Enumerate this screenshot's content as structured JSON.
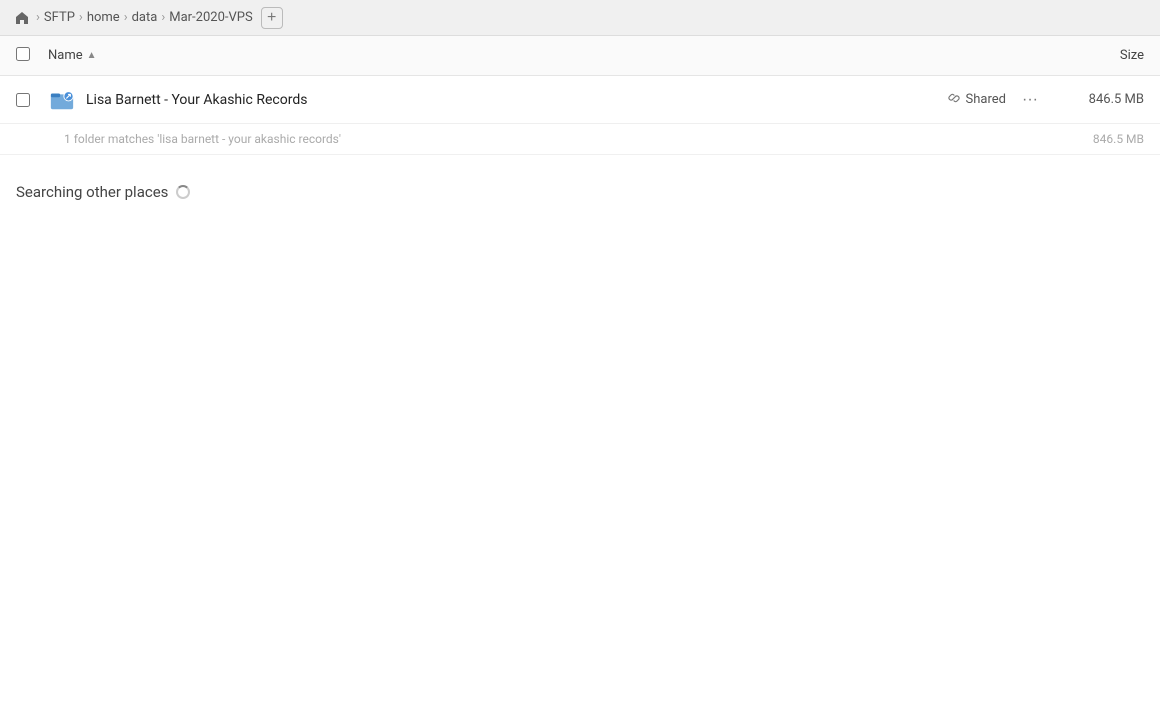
{
  "breadcrumb": {
    "home_label": "home",
    "items": [
      {
        "label": "SFTP"
      },
      {
        "label": "home"
      },
      {
        "label": "data"
      },
      {
        "label": "Mar-2020-VPS"
      }
    ],
    "add_button_label": "+"
  },
  "file_list": {
    "header": {
      "name_label": "Name",
      "sort_indicator": "▲",
      "size_label": "Size"
    },
    "rows": [
      {
        "name": "Lisa Barnett - Your Akashic Records",
        "shared_label": "Shared",
        "size": "846.5 MB"
      }
    ],
    "search_result_info": "1 folder matches 'lisa barnett - your akashic records'",
    "search_result_size": "846.5 MB",
    "searching_label": "Searching other places"
  },
  "icons": {
    "home": "⌂",
    "link": "🔗",
    "more": "···",
    "chevron_right": "›"
  }
}
